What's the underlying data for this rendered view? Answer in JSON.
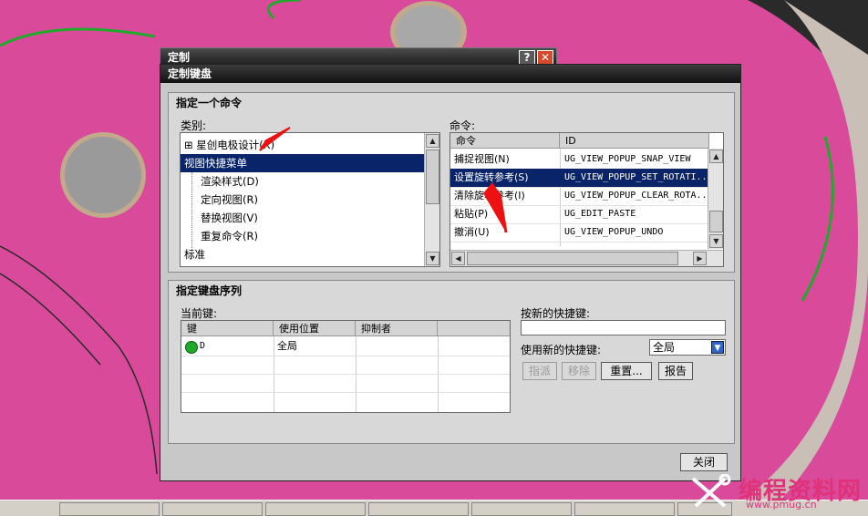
{
  "outer_window": {
    "title": "定制",
    "help": "?",
    "close": "✕"
  },
  "dialog": {
    "title": "定制键盘",
    "command_group": {
      "title": "指定一个命令",
      "category_label": "类别:",
      "categories": [
        {
          "label": "星创电极设计(X)",
          "expander": "⊞"
        },
        {
          "label": "视图快捷菜单"
        },
        {
          "label": "渲染样式(D)"
        },
        {
          "label": "定向视图(R)"
        },
        {
          "label": "替换视图(V)"
        },
        {
          "label": "重复命令(R)"
        },
        {
          "label": "标准"
        }
      ],
      "command_label": "命令:",
      "command_columns": [
        "命令",
        "ID"
      ],
      "commands": [
        {
          "name": "捕捉视图(N)",
          "id": "UG_VIEW_POPUP_SNAP_VIEW"
        },
        {
          "name": "设置旋转参考(S)",
          "id": "UG_VIEW_POPUP_SET_ROTATI..."
        },
        {
          "name": "清除旋转参考(I)",
          "id": "UG_VIEW_POPUP_CLEAR_ROTA..."
        },
        {
          "name": "粘贴(P)",
          "id": "UG_EDIT_PASTE"
        },
        {
          "name": "撤消(U)",
          "id": "UG_VIEW_POPUP_UNDO"
        }
      ]
    },
    "key_group": {
      "title": "指定键盘序列",
      "current_keys_label": "当前键:",
      "key_columns": [
        "键",
        "使用位置",
        "抑制者"
      ],
      "keys": [
        {
          "key": "D",
          "location": "全局",
          "suppressor": ""
        }
      ],
      "new_shortcut_label": "按新的快捷键:",
      "new_shortcut_value": "",
      "use_new_label": "使用新的快捷键:",
      "use_new_value": "全局",
      "assign_button": "指派",
      "remove_button": "移除",
      "reset_button": "重置...",
      "report_button": "报告"
    },
    "close_button": "关闭"
  },
  "watermark": {
    "text": "编程资料网",
    "url": "www.pmug.cn"
  },
  "colors": {
    "selection": "#0a246a",
    "cad_part": "#d94b9a",
    "status_green": "#1faa2a"
  }
}
